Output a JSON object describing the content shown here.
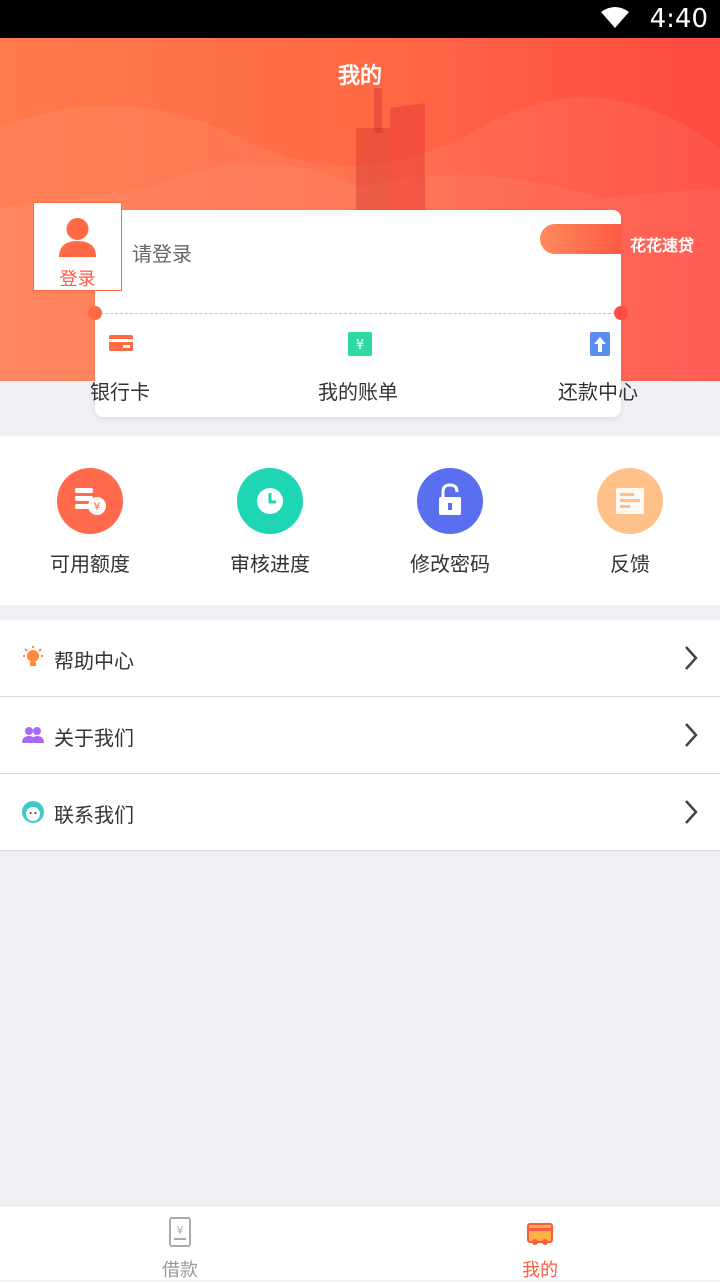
{
  "status_bar": {
    "time": "4:40"
  },
  "header": {
    "title": "我的"
  },
  "user": {
    "avatar_label": "登录",
    "login_prompt": "请登录",
    "brand_name": "花花速贷"
  },
  "quick_actions": [
    {
      "label": "银行卡",
      "icon": "bank-card-icon"
    },
    {
      "label": "我的账单",
      "icon": "bill-icon"
    },
    {
      "label": "还款中心",
      "icon": "repay-icon"
    }
  ],
  "grid": [
    {
      "label": "可用额度",
      "icon": "coins-icon",
      "color": "#ff6a4d"
    },
    {
      "label": "审核进度",
      "icon": "clock-icon",
      "color": "#1ed6b3"
    },
    {
      "label": "修改密码",
      "icon": "lock-icon",
      "color": "#5a6ef0"
    },
    {
      "label": "反馈",
      "icon": "feedback-icon",
      "color": "#ffc08a"
    }
  ],
  "menu": [
    {
      "label": "帮助中心",
      "icon": "lightbulb-icon"
    },
    {
      "label": "关于我们",
      "icon": "users-icon"
    },
    {
      "label": "联系我们",
      "icon": "service-icon"
    }
  ],
  "tabbar": [
    {
      "label": "借款",
      "icon": "loan-icon",
      "active": false
    },
    {
      "label": "我的",
      "icon": "wallet-icon",
      "active": true
    }
  ],
  "colors": {
    "accent": "#ff5a43",
    "inactive": "#999999"
  }
}
